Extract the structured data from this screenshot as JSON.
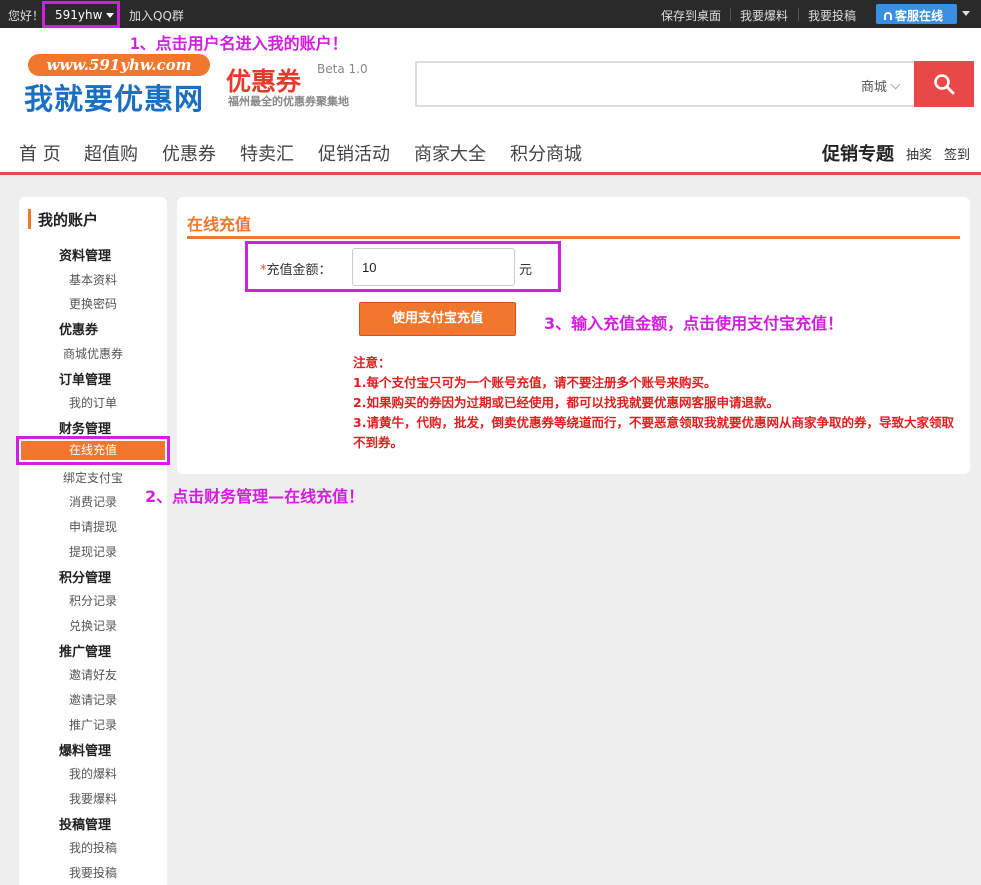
{
  "topbar": {
    "greeting": "您好！",
    "username": "591yhw",
    "qq_group": "加入QQ群",
    "save_desktop": "保存到桌面",
    "submit_deal": "我要爆料",
    "submit_article": "我要投稿",
    "service": "客服在线"
  },
  "annotations": {
    "step1": "1、点击用户名进入我的账户！",
    "step2": "2、点击财务管理—在线充值！",
    "step3": "3、输入充值金额，点击使用支付宝充值！"
  },
  "logo": {
    "url_text": "www.591yhw.com",
    "main": "我就要优惠网",
    "coupon": "优惠券",
    "beta": "Beta 1.0",
    "subtitle": "福州最全的优惠券聚集地"
  },
  "search": {
    "value": "",
    "scope": "商城"
  },
  "nav": {
    "items": [
      "首 页",
      "超值购",
      "优惠券",
      "特卖汇",
      "促销活动",
      "商家大全",
      "积分商城"
    ],
    "promo": "促销专题",
    "lottery": "抽奖",
    "checkin": "签到"
  },
  "sidebar": {
    "title": "我的账户",
    "groups": [
      {
        "label": "资料管理",
        "items": [
          "基本资料",
          "更换密码"
        ]
      },
      {
        "label": "优惠券",
        "items": [
          "商城优惠券"
        ]
      },
      {
        "label": "订单管理",
        "items": [
          "我的订单"
        ]
      },
      {
        "label": "财务管理",
        "items": [
          "在线充值",
          "绑定支付宝",
          "消费记录",
          "申请提现",
          "提现记录"
        ]
      },
      {
        "label": "积分管理",
        "items": [
          "积分记录",
          "兑换记录"
        ]
      },
      {
        "label": "推广管理",
        "items": [
          "邀请好友",
          "邀请记录",
          "推广记录"
        ]
      },
      {
        "label": "爆料管理",
        "items": [
          "我的爆料",
          "我要爆料"
        ]
      },
      {
        "label": "投稿管理",
        "items": [
          "我的投稿",
          "我要投稿"
        ]
      }
    ]
  },
  "recharge": {
    "title": "在线充值",
    "required_mark": "*",
    "amount_label": "充值金额：",
    "amount_value": "10",
    "unit": "元",
    "pay_button": "使用支付宝充值",
    "notes": [
      "注意：",
      "1.每个支付宝只可为一个账号充值，请不要注册多个账号来购买。",
      "2.如果购买的券因为过期或已经使用，都可以找我就要优惠网客服申请退款。",
      "3.请黄牛，代购，批发，倒卖优惠券等绕道而行，不要恶意领取我就要优惠网从商家争取的券，导致大家领取不到券。"
    ]
  },
  "colors": {
    "accent": "#f0772d",
    "highlight": "#d21ee0",
    "alert": "#e02020",
    "search_button": "#e94848",
    "service_button": "#3b8fe0"
  }
}
